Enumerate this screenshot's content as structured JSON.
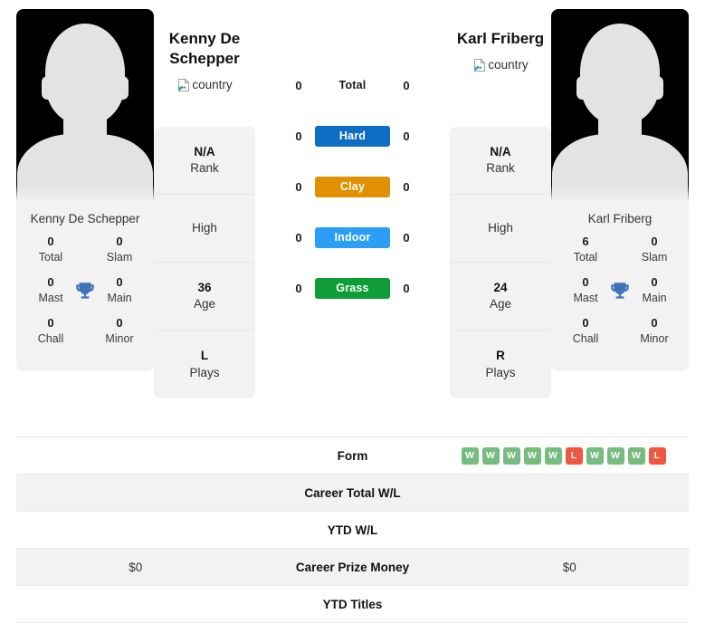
{
  "players": {
    "left": {
      "name": "Kenny De Schepper",
      "card_name": "Kenny De Schepper",
      "country_alt": "country",
      "titles": [
        {
          "value": "0",
          "label": "Total"
        },
        {
          "value": "0",
          "label": "Slam"
        },
        {
          "value": "0",
          "label": "Mast"
        },
        {
          "value": "0",
          "label": "Main"
        },
        {
          "value": "0",
          "label": "Chall"
        },
        {
          "value": "0",
          "label": "Minor"
        }
      ],
      "info": [
        {
          "value": "N/A",
          "label": "Rank"
        },
        {
          "value": "",
          "label": "High"
        },
        {
          "value": "36",
          "label": "Age"
        },
        {
          "value": "L",
          "label": "Plays"
        }
      ],
      "surface_counts": {
        "total": "0",
        "hard": "0",
        "clay": "0",
        "indoor": "0",
        "grass": "0"
      },
      "form": [],
      "career_total_wl": "",
      "ytd_wl": "",
      "career_prize_money": "$0",
      "ytd_titles": ""
    },
    "right": {
      "name": "Karl Friberg",
      "card_name": "Karl Friberg",
      "country_alt": "country",
      "titles": [
        {
          "value": "6",
          "label": "Total"
        },
        {
          "value": "0",
          "label": "Slam"
        },
        {
          "value": "0",
          "label": "Mast"
        },
        {
          "value": "0",
          "label": "Main"
        },
        {
          "value": "0",
          "label": "Chall"
        },
        {
          "value": "0",
          "label": "Minor"
        }
      ],
      "info": [
        {
          "value": "N/A",
          "label": "Rank"
        },
        {
          "value": "",
          "label": "High"
        },
        {
          "value": "24",
          "label": "Age"
        },
        {
          "value": "R",
          "label": "Plays"
        }
      ],
      "surface_counts": {
        "total": "0",
        "hard": "0",
        "clay": "0",
        "indoor": "0",
        "grass": "0"
      },
      "form": [
        "W",
        "W",
        "W",
        "W",
        "W",
        "L",
        "W",
        "W",
        "W",
        "L"
      ],
      "career_total_wl": "",
      "ytd_wl": "",
      "career_prize_money": "$0",
      "ytd_titles": ""
    }
  },
  "surfaces": [
    {
      "key": "total",
      "label": "Total",
      "color": "transparent",
      "plain": true
    },
    {
      "key": "hard",
      "label": "Hard",
      "color": "#0d6dc4",
      "plain": false
    },
    {
      "key": "clay",
      "label": "Clay",
      "color": "#e09000",
      "plain": false
    },
    {
      "key": "indoor",
      "label": "Indoor",
      "color": "#2b9ef5",
      "plain": false
    },
    {
      "key": "grass",
      "label": "Grass",
      "color": "#0f9d38",
      "plain": false
    }
  ],
  "table_rows": [
    {
      "key": "form",
      "label": "Form"
    },
    {
      "key": "career_total_wl",
      "label": "Career Total W/L"
    },
    {
      "key": "ytd_wl",
      "label": "YTD W/L"
    },
    {
      "key": "career_prize_money",
      "label": "Career Prize Money"
    },
    {
      "key": "ytd_titles",
      "label": "YTD Titles"
    }
  ],
  "colors": {
    "win": "#76bb7f",
    "loss": "#f0573f",
    "card_bg": "#f2f2f2",
    "trophy": "#3f72b9"
  },
  "icons": {
    "trophy": "trophy-icon",
    "broken_image": "broken-image-icon"
  }
}
